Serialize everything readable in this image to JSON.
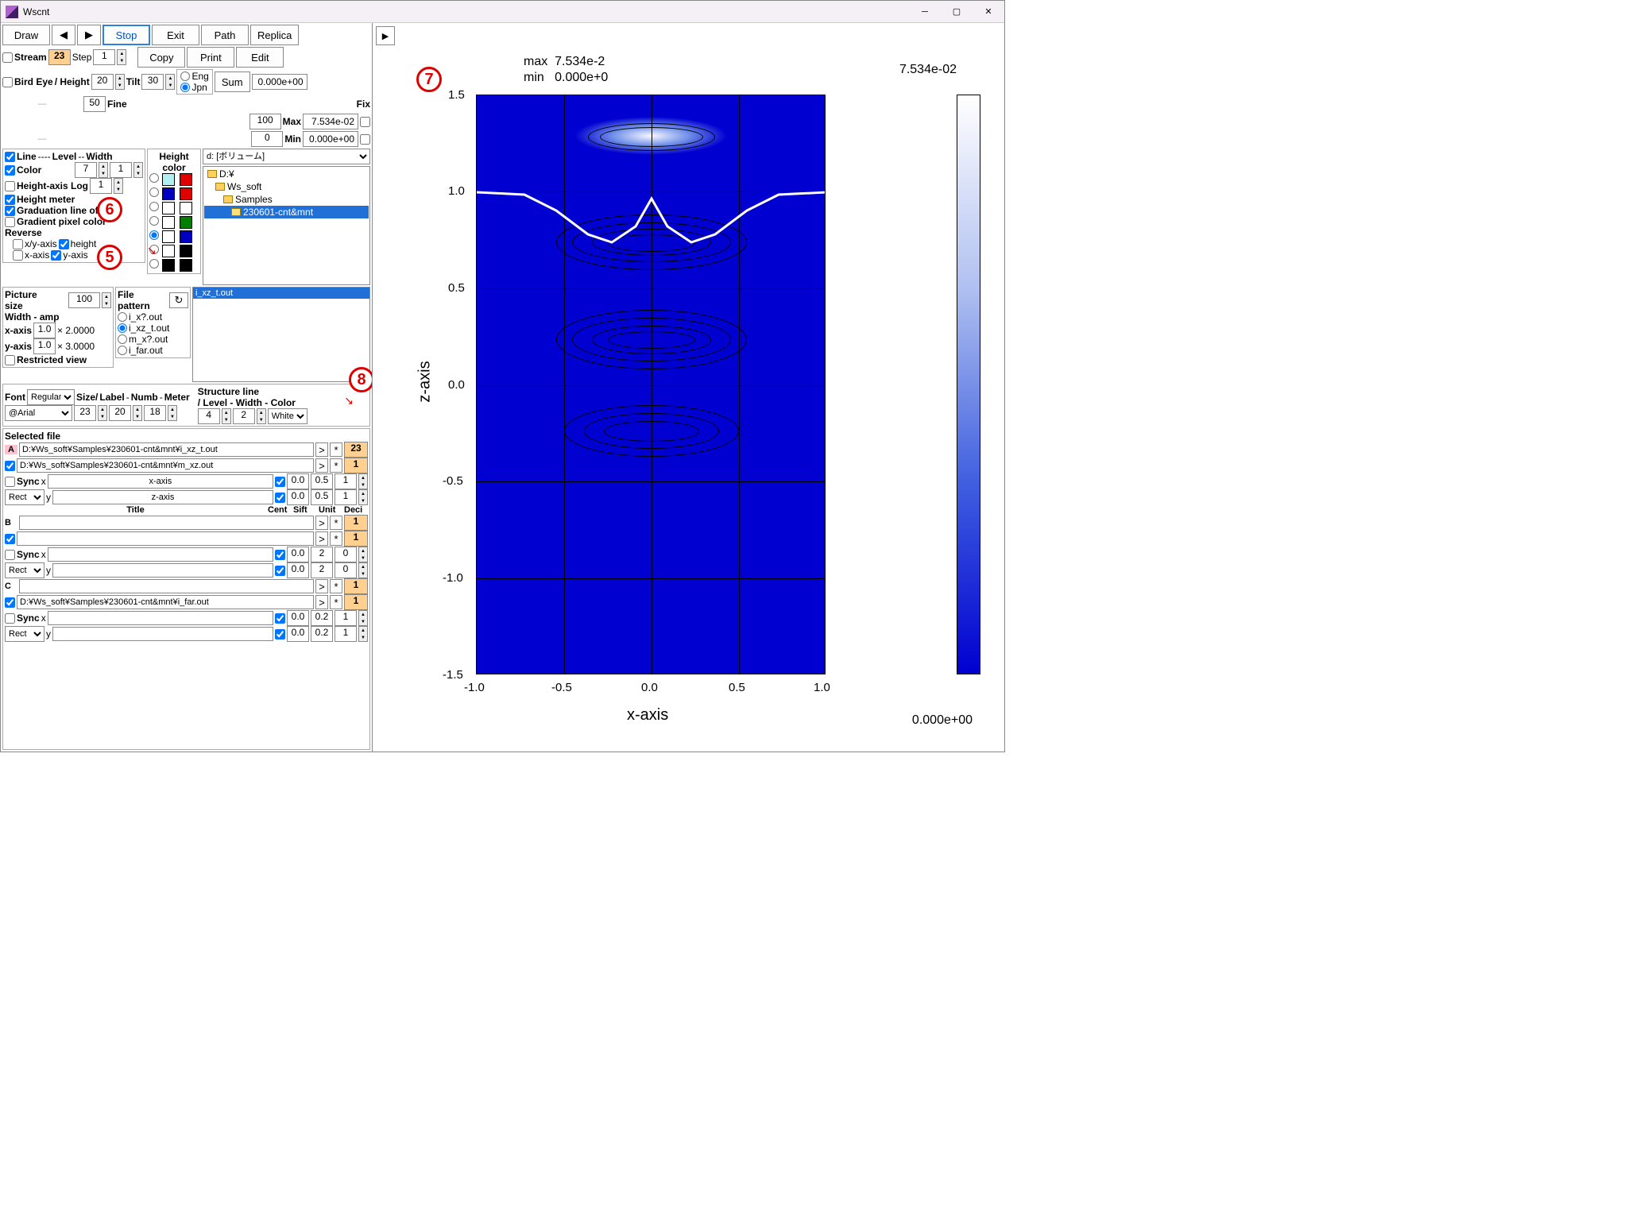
{
  "window": {
    "title": "Wscnt"
  },
  "toolbar": {
    "draw": "Draw",
    "stop": "Stop",
    "exit": "Exit",
    "path": "Path",
    "replica": "Replica",
    "copy": "Copy",
    "print": "Print",
    "edit": "Edit",
    "stream": "Stream",
    "stream_val": "23",
    "step": "Step",
    "step_val": "1",
    "birdeye": "Bird Eye",
    "height": "/ Height",
    "height_val": "20",
    "tilt": "Tilt",
    "tilt_val": "30",
    "fine_val": "50",
    "fine": "Fine",
    "hundred": "100",
    "eng": "Eng",
    "jpn": "Jpn",
    "sum": "Sum",
    "sum_val": "0.000e+00",
    "max": "Max",
    "max_val": "7.534e-02",
    "zero": "0",
    "min": "Min",
    "min_val": "0.000e+00",
    "fix": "Fix"
  },
  "line_opts": {
    "line": "Line",
    "level": "Level",
    "width": "Width",
    "color": "Color",
    "color_val": "7",
    "width_val": "1",
    "hlog": "Height-axis Log",
    "hlog_val": "1",
    "hmeter": "Height meter",
    "grad": "Graduation line of axis",
    "gradpix": "Gradient pixel color",
    "reverse": "Reverse",
    "xy": "x/y-axis",
    "height": "height",
    "x": "x-axis",
    "y": "y-axis"
  },
  "heightcolor": {
    "label": "Height\ncolor"
  },
  "drive": {
    "label": "d: [ボリューム]",
    "path1": "D:¥",
    "path2": "Ws_soft",
    "path3": "Samples",
    "path4": "230601-cnt&mnt"
  },
  "filelist": {
    "sel": "i_xz_t.out"
  },
  "picsize": {
    "label": "Picture\nsize",
    "val": "100",
    "wamp": "Width - amp",
    "xaxis": "x-axis",
    "xval": "1.0",
    "xmul": "× 2.0000",
    "yaxis": "y-axis",
    "yval": "1.0",
    "ymul": "× 3.0000",
    "restrict": "Restricted view"
  },
  "filepat": {
    "label": "File\npattern",
    "p1": "i_x?.out",
    "p2": "i_xz_t.out",
    "p3": "m_x?.out",
    "p4": "i_far.out"
  },
  "fontrow": {
    "font": "Font",
    "reg": "Regular",
    "arial": "@Arial",
    "size": "Size/",
    "label": "Label",
    "numb": "Numb",
    "meter": "Meter",
    "v1": "23",
    "v2": "20",
    "v3": "18",
    "struct": "Structure line",
    "lwc": "/ Level - Width - Color",
    "lv": "4",
    "wd": "2",
    "col": "White"
  },
  "selfile": {
    "header": "Selected file",
    "a": "A",
    "a_path": "D:¥Ws_soft¥Samples¥230601-cnt&mnt¥i_xz_t.out",
    "a_num": "23",
    "a2_path": "D:¥Ws_soft¥Samples¥230601-cnt&mnt¥m_xz.out",
    "a2_num": "1",
    "sync": "Sync",
    "rect": "Rect",
    "x": "x",
    "y": "y",
    "xaxis": "x-axis",
    "zaxis": "z-axis",
    "v00": "0.0",
    "v05": "0.5",
    "v1": "1",
    "v2": "2",
    "v02": "0.2",
    "v0": "0",
    "title": "Title",
    "cent": "Cent",
    "sift": "Sift",
    "unit": "Unit",
    "deci": "Deci",
    "b": "B",
    "c": "C",
    "c_path": "D:¥Ws_soft¥Samples¥230601-cnt&mnt¥i_far.out",
    "gt": ">",
    "star": "*"
  },
  "plot": {
    "max_lbl": "max",
    "max_val": "7.534e-2",
    "min_lbl": "min",
    "min_val": "0.000e+0",
    "cb_top": "7.534e-02",
    "cb_bot": "0.000e+00",
    "xlabel": "x-axis",
    "ylabel": "z-axis",
    "xticks": [
      "-1.0",
      "-0.5",
      "0.0",
      "0.5",
      "1.0"
    ],
    "yticks": [
      "1.5",
      "1.0",
      "0.5",
      "0.0",
      "-0.5",
      "-1.0",
      "-1.5"
    ]
  },
  "callouts": {
    "c5": "5",
    "c6": "6",
    "c7": "7",
    "c8": "8"
  }
}
